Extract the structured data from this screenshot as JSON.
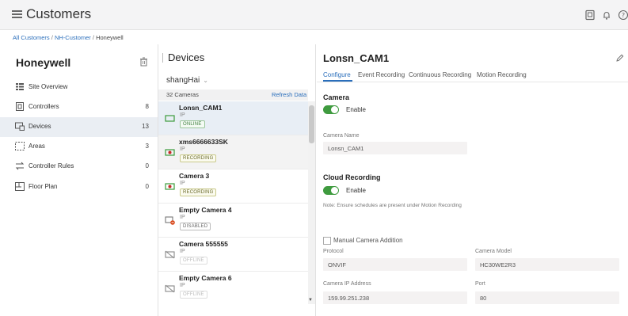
{
  "app": {
    "title": "Customers"
  },
  "breadcrumb": {
    "root": "All Customers",
    "sep": " / ",
    "customer": "NH-Customer",
    "current": "Honeywell"
  },
  "sidebar": {
    "org_name": "Honeywell",
    "items": [
      {
        "label": "Site Overview",
        "count": "",
        "icon": "site-overview-icon"
      },
      {
        "label": "Controllers",
        "count": "8",
        "icon": "controller-icon"
      },
      {
        "label": "Devices",
        "count": "13",
        "icon": "devices-icon"
      },
      {
        "label": "Areas",
        "count": "3",
        "icon": "areas-icon"
      },
      {
        "label": "Controller Rules",
        "count": "0",
        "icon": "rules-icon"
      },
      {
        "label": "Floor Plan",
        "count": "0",
        "icon": "floor-plan-icon"
      }
    ]
  },
  "devices": {
    "title": "Devices",
    "site": "shangHai",
    "camera_count": "32 Cameras",
    "refresh_label": "Refresh Data",
    "list": [
      {
        "name": "Lonsn_CAM1",
        "type": "IP",
        "status": "ONLINE",
        "icon": "camera-online-icon"
      },
      {
        "name": "xms6666633SK",
        "type": "IP",
        "status": "RECORDING",
        "icon": "camera-recording-icon"
      },
      {
        "name": "Camera 3",
        "type": "IP",
        "status": "RECORDING",
        "icon": "camera-recording-icon"
      },
      {
        "name": "Empty Camera 4",
        "type": "IP",
        "status": "DISABLED",
        "icon": "camera-disabled-icon"
      },
      {
        "name": "Camera 555555",
        "type": "IP",
        "status": "OFFLINE",
        "icon": "camera-offline-icon"
      },
      {
        "name": "Empty Camera 6",
        "type": "IP",
        "status": "OFFLINE",
        "icon": "camera-offline-icon"
      }
    ]
  },
  "detail": {
    "title": "Lonsn_CAM1",
    "tabs": [
      "Configure",
      "Event Recording",
      "Continuous Recording",
      "Motion Recording"
    ],
    "camera_section": "Camera",
    "enable_label": "Enable",
    "camera_name_label": "Camera Name",
    "camera_name_value": "Lonsn_CAM1",
    "cloud_section": "Cloud Recording",
    "cloud_enable_label": "Enable",
    "note": "Note: Ensure schedules are present under Motion Recording",
    "manual_label": "Manual Camera Addition",
    "protocol_label": "Protocol",
    "protocol_value": "ONVIF",
    "model_label": "Camera Model",
    "model_value": "HC30WE2R3",
    "ip_label": "Camera IP Address",
    "ip_value": "159.99.251.238",
    "port_label": "Port",
    "port_value": "80"
  },
  "colors": {
    "accent": "#2a6ebb",
    "toggle_on": "#3f9b3f",
    "active_row": "#e8eef5"
  }
}
